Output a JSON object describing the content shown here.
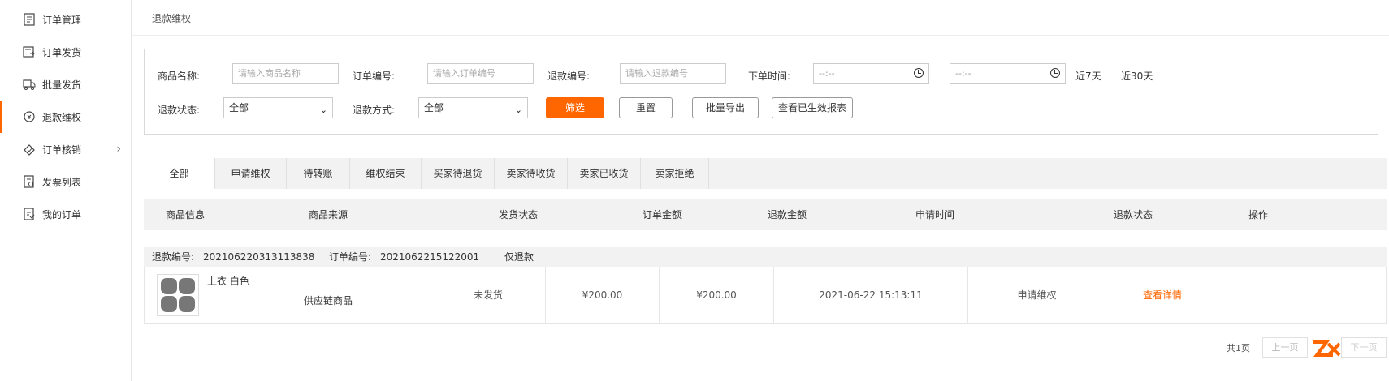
{
  "sidebar": {
    "items": [
      {
        "label": "订单管理",
        "icon": "document-icon"
      },
      {
        "label": "订单发货",
        "icon": "ship-order-icon"
      },
      {
        "label": "批量发货",
        "icon": "truck-icon"
      },
      {
        "label": "退款维权",
        "icon": "refund-icon",
        "active": true
      },
      {
        "label": "订单核销",
        "icon": "verify-icon",
        "has_submenu": true
      },
      {
        "label": "发票列表",
        "icon": "invoice-icon"
      },
      {
        "label": "我的订单",
        "icon": "my-order-icon"
      }
    ]
  },
  "breadcrumb": "退款维权",
  "filter": {
    "product_name_label": "商品名称:",
    "product_name_placeholder": "请输入商品名称",
    "order_no_label": "订单编号:",
    "order_no_placeholder": "请输入订单编号",
    "refund_no_label": "退款编号:",
    "refund_no_placeholder": "请输入退款编号",
    "order_time_label": "下单时间:",
    "time_start": "--:--",
    "time_sep": "-",
    "time_end": "--:--",
    "last7": "近7天",
    "last30": "近30天",
    "refund_status_label": "退款状态:",
    "refund_status_value": "全部",
    "refund_method_label": "退款方式:",
    "refund_method_value": "全部",
    "filter_button": "筛选",
    "reset_button": "重置",
    "export_button": "批量导出",
    "report_button": "查看已生效报表"
  },
  "tabs": [
    "全部",
    "申请维权",
    "待转账",
    "维权结束",
    "买家待退货",
    "卖家待收货",
    "卖家已收货",
    "卖家拒绝"
  ],
  "table": {
    "headers": [
      "商品信息",
      "商品来源",
      "发货状态",
      "订单金额",
      "退款金额",
      "申请时间",
      "退款状态",
      "操作"
    ],
    "orders": [
      {
        "refund_no_label": "退款编号:",
        "refund_no": "202106220313113838",
        "order_no_label": "订单编号:",
        "order_no": "2021062215122001",
        "refund_type": "仅退款",
        "product_name": "上衣 白色",
        "source": "供应链商品",
        "ship_status": "未发货",
        "order_amount": "¥200.00",
        "refund_amount": "¥200.00",
        "apply_time": "2021-06-22 15:13:11",
        "refund_status": "申请维权",
        "action": "查看详情"
      }
    ]
  },
  "pager": {
    "total_text": "共1页",
    "prev": "上一页",
    "next": "下一页"
  },
  "colors": {
    "accent": "#ff6600"
  }
}
